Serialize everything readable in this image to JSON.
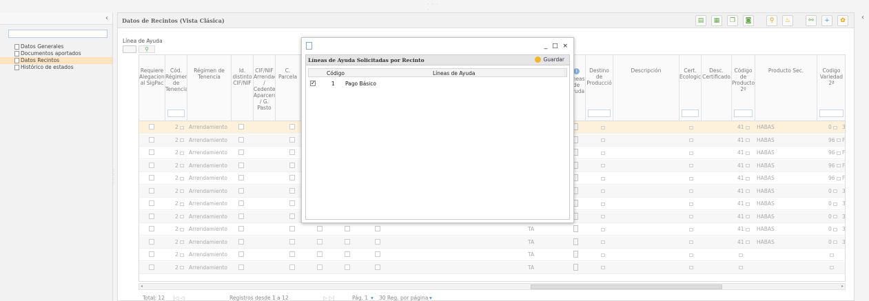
{
  "left_panel": {
    "collapse_glyph": "‹",
    "search_placeholder": "",
    "items": [
      {
        "label": "Datos Generales",
        "active": false
      },
      {
        "label": "Documentos aportados",
        "active": false
      },
      {
        "label": "Datos Recintos",
        "active": true
      },
      {
        "label": "Histórico de estados",
        "active": false
      }
    ]
  },
  "main": {
    "title": "Datos de Recintos (Vista Clásica)",
    "linea_label": "Línea de Ayuda",
    "toolbar_icons": [
      "sheet-icon",
      "table-icon",
      "copy-icon",
      "photo-icon",
      "search-icon",
      "bulb-icon",
      "link-icon",
      "add-icon",
      "gear-icon"
    ],
    "right_collapse": "‹"
  },
  "grid": {
    "columns": {
      "requiere": "Requiere Alegaciones al SigPac",
      "cod_regimen": "Cód. Régimen de Tenencia",
      "regimen": "Régimen de Tenencia",
      "id_distinto": "Id. distinto CIF/NIF",
      "cif_nif": "CIF/NIF Arrendador / Cedente Aparcero / G. Pasto",
      "c_parcela": "C. Parcela",
      "lineas": "Líneas de Ayuda",
      "destino": "Destino de Producció",
      "descripcion": "Descripción",
      "cert": "Cert. Ecologic",
      "desc_cert": "Desc. Certificado",
      "codigo_prod": "Código de Producto 2º",
      "producto_sec": "Producto Sec.",
      "codigo_var": "Codigo Variedad 2ª"
    },
    "rows": [
      {
        "cod": "2",
        "regimen": "Arrendamiento",
        "ta": "",
        "codprod": "41",
        "producto": "HABAS",
        "codvar": "0",
        "tail": "3"
      },
      {
        "cod": "2",
        "regimen": "Arrendamiento",
        "ta": "",
        "codprod": "41",
        "producto": "HABAS",
        "codvar": "96",
        "tail": "F"
      },
      {
        "cod": "2",
        "regimen": "Arrendamiento",
        "ta": "",
        "codprod": "41",
        "producto": "HABAS",
        "codvar": "96",
        "tail": "F"
      },
      {
        "cod": "2",
        "regimen": "Arrendamiento",
        "ta": "",
        "codprod": "41",
        "producto": "HABAS",
        "codvar": "96",
        "tail": "F"
      },
      {
        "cod": "2",
        "regimen": "Arrendamiento",
        "ta": "",
        "codprod": "41",
        "producto": "HABAS",
        "codvar": "96",
        "tail": "F"
      },
      {
        "cod": "2",
        "regimen": "Arrendamiento",
        "ta": "",
        "codprod": "41",
        "producto": "HABAS",
        "codvar": "0",
        "tail": "3"
      },
      {
        "cod": "2",
        "regimen": "Arrendamiento",
        "ta": "",
        "codprod": "41",
        "producto": "HABAS",
        "codvar": "0",
        "tail": "3"
      },
      {
        "cod": "2",
        "regimen": "Arrendamiento",
        "ta": "",
        "codprod": "41",
        "producto": "HABAS",
        "codvar": "0",
        "tail": "3"
      },
      {
        "cod": "2",
        "regimen": "Arrendamiento",
        "ta": "TA",
        "codprod": "41",
        "producto": "HABAS",
        "codvar": "0",
        "tail": "3"
      },
      {
        "cod": "2",
        "regimen": "Arrendamiento",
        "ta": "TA",
        "codprod": "41",
        "producto": "HABAS",
        "codvar": "0",
        "tail": "3"
      },
      {
        "cod": "2",
        "regimen": "Arrendamiento",
        "ta": "TA",
        "codprod": "",
        "producto": "",
        "codvar": "",
        "tail": ""
      },
      {
        "cod": "2",
        "regimen": "Arrendamiento",
        "ta": "TA",
        "codprod": "",
        "producto": "",
        "codvar": "",
        "tail": ""
      }
    ]
  },
  "footer": {
    "total": "Total: 12",
    "registros": "Registros desde 1 a 12",
    "pagina": "Pág. 1",
    "por_pagina": "30 Reg. por página"
  },
  "modal": {
    "controls": "_ □ ×",
    "title": "Líneas de Ayuda Solicitadas por Recinto",
    "guardar": "Guardar",
    "col_codigo": "Código",
    "col_lineas": "Líneas de Ayuda",
    "rows": [
      {
        "checked": "✓",
        "codigo": "1",
        "linea": "Pago Básico"
      }
    ]
  }
}
